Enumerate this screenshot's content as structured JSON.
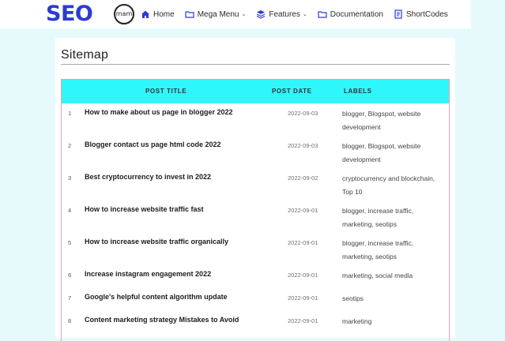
{
  "header": {
    "logo_text": "SEO",
    "logo_badge": "mam",
    "nav": [
      {
        "label": "Home",
        "icon": "home-icon",
        "dropdown": false
      },
      {
        "label": "Mega Menu",
        "icon": "folder-icon",
        "dropdown": true
      },
      {
        "label": "Features",
        "icon": "layers-icon",
        "dropdown": true
      },
      {
        "label": "Documentation",
        "icon": "folder-icon",
        "dropdown": false
      },
      {
        "label": "ShortCodes",
        "icon": "shortcode-icon",
        "dropdown": false
      }
    ]
  },
  "page": {
    "title": "Sitemap"
  },
  "table": {
    "headers": {
      "title": "POST TITLE",
      "date": "POST DATE",
      "labels": "LABELS"
    },
    "rows": [
      {
        "num": "1",
        "title": "How to make about us page in blogger 2022",
        "date": "2022-09-03",
        "labels": "blogger, Blogspot, website development"
      },
      {
        "num": "2",
        "title": "Blogger contact us page html code 2022",
        "date": "2022-09-03",
        "labels": "blogger, Blogspot, website development"
      },
      {
        "num": "3",
        "title": "Best cryptocurrency to invest in 2022",
        "date": "2022-09-02",
        "labels": "cryptocurrency and blockchain, Top 10"
      },
      {
        "num": "4",
        "title": "How to increase website traffic fast",
        "date": "2022-09-01",
        "labels": "blogger, increase traffic, marketing, seotips"
      },
      {
        "num": "5",
        "title": "How to increase website traffic organically",
        "date": "2022-09-01",
        "labels": "blogger, increase traffic, marketing, seotips"
      },
      {
        "num": "6",
        "title": "Increase instagram engagement 2022",
        "date": "2022-09-01",
        "labels": "marketing, social media"
      },
      {
        "num": "7",
        "title": "Google's helpful content algorithm update",
        "date": "2022-09-01",
        "labels": "seotips"
      },
      {
        "num": "8",
        "title": "Content marketing strategy Mistakes to Avoid",
        "date": "2022-09-01",
        "labels": "marketing"
      }
    ]
  },
  "colors": {
    "brand": "#2a3bd6",
    "table_header": "#2ff6fb",
    "background": "#e6fafc"
  }
}
